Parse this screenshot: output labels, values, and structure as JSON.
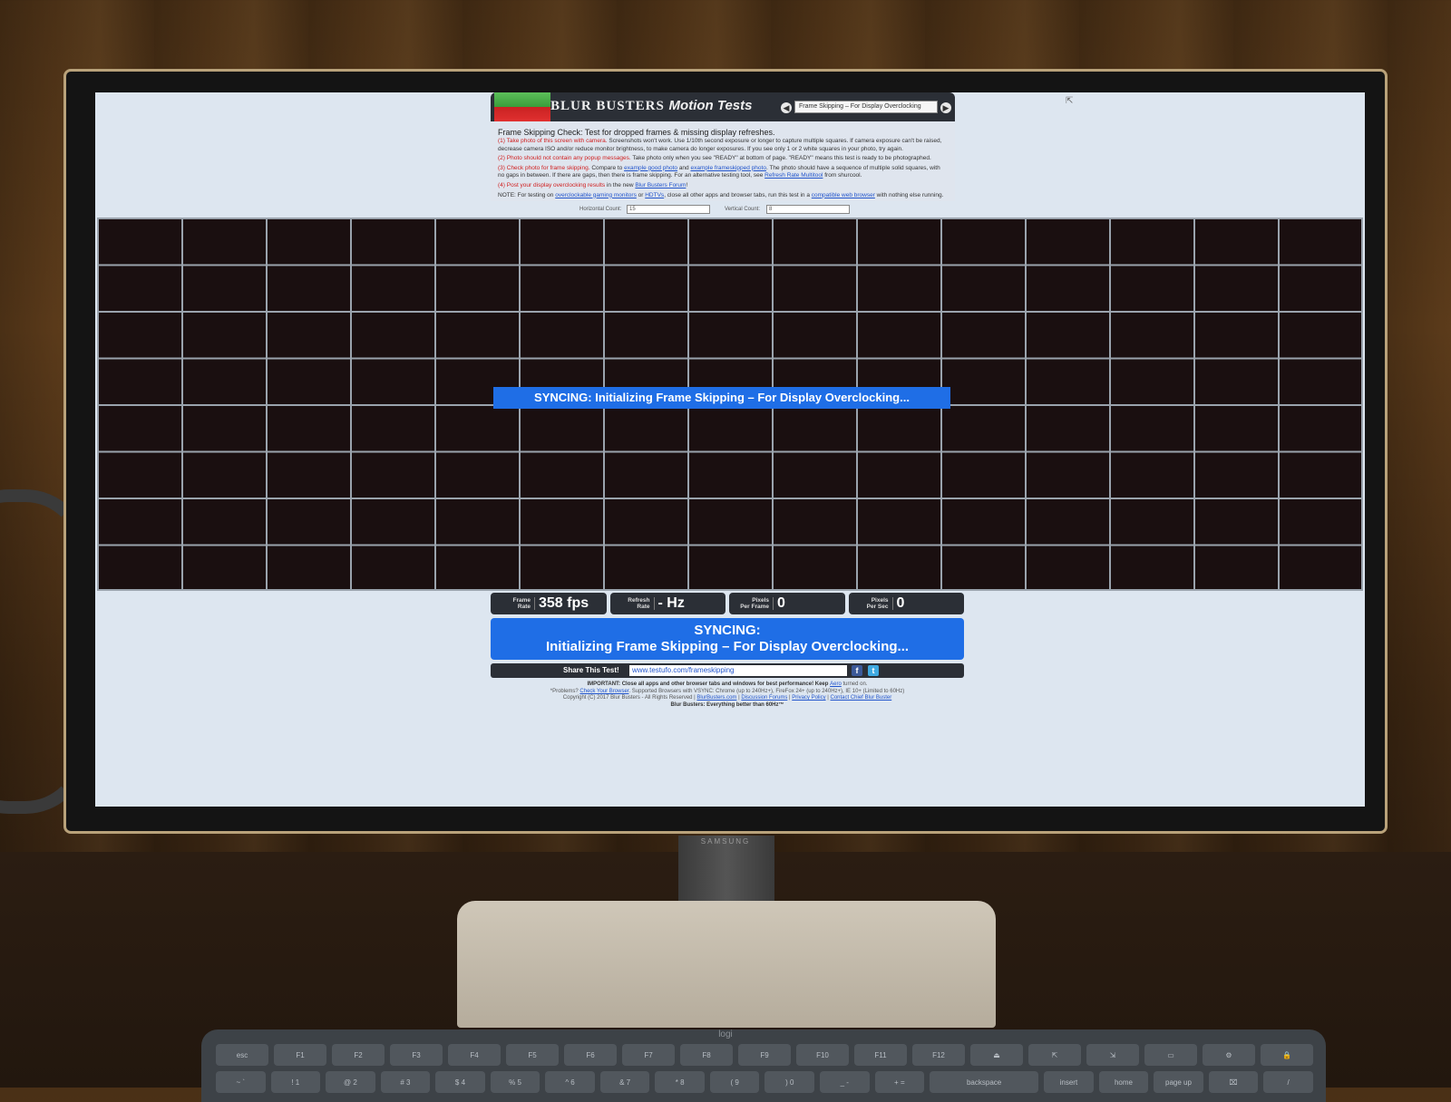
{
  "header": {
    "brand": "BLUR  BUSTERS",
    "brand_suffix": "Motion Tests",
    "test_selector_value": "Frame Skipping – For Display Overclocking"
  },
  "description": {
    "title": "Frame Skipping Check: Test for dropped frames & missing display refreshes.",
    "step1_red": "(1) Take photo of this screen with camera.",
    "step1_text": " Screenshots won't work. Use 1/10th second exposure or longer to capture multiple squares. If camera exposure can't be raised, decrease camera ISO and/or reduce monitor brightness, to make camera do longer exposures. If you see only 1 or 2 white squares in your photo, try again.",
    "step2_red": "(2) Photo should not contain any popup messages.",
    "step2_text": " Take photo only when you see \"READY\" at bottom of page. \"READY\" means this test is ready to be photographed.",
    "step3_red": "(3) Check photo for frame skipping.",
    "step3_text_a": " Compare to ",
    "step3_link_a": "example good photo",
    "step3_text_b": " and ",
    "step3_link_b": "example frameskipped photo",
    "step3_text_c": ". The photo should have a sequence of multiple solid squares, with no gaps in between. If there are gaps, then there is frame skipping. For an alternative testing tool, see ",
    "step3_link_c": "Refresh Rate Multitool",
    "step3_text_d": " from shurcool.",
    "step4_red": "(4) Post your display overclocking results",
    "step4_text": " in the new ",
    "step4_link": "Blur Busters Forum",
    "step4_end": "!",
    "note_a": "NOTE: For testing on ",
    "note_link_a": "overclockable gaming monitors",
    "note_b": " or ",
    "note_link_b": "HDTVs",
    "note_c": ", close all other apps and browser tabs, run this test in a ",
    "note_link_c": "compatible web browser",
    "note_d": " with nothing else running."
  },
  "counts": {
    "horizontal_label": "Horizontal Count:",
    "horizontal_value": "15",
    "vertical_label": "Vertical Count:",
    "vertical_value": "8"
  },
  "overlay": {
    "sync_banner": "SYNCING: Initializing Frame Skipping – For Display Overclocking..."
  },
  "stats": {
    "frame_rate_label_1": "Frame",
    "frame_rate_label_2": "Rate",
    "frame_rate_value": "358 fps",
    "refresh_rate_label_1": "Refresh",
    "refresh_rate_label_2": "Rate",
    "refresh_rate_value": "- Hz",
    "ppf_label_1": "Pixels",
    "ppf_label_2": "Per Frame",
    "ppf_value": "0",
    "pps_label_1": "Pixels",
    "pps_label_2": "Per Sec",
    "pps_value": "0"
  },
  "status": {
    "line1": "SYNCING:",
    "line2": "Initializing Frame Skipping – For Display Overclocking..."
  },
  "share": {
    "label": "Share This Test!",
    "url": "www.testufo.com/frameskipping",
    "facebook_icon": "f",
    "twitter_icon": "t"
  },
  "footer": {
    "important_a": "IMPORTANT: Close all apps and other browser tabs and windows for best performance! Keep ",
    "important_link": "Aero",
    "important_b": " turned on.",
    "problems_a": "*Problems? ",
    "problems_link": "Check Your Browser",
    "problems_b": ". Supported Browsers with VSYNC: Chrome (up to 240Hz+), FireFox 24+ (up to 240Hz+), IE 10+ (Limited to 60Hz)",
    "copyright": "Copyright (C) 2017 Blur Busters - All Rights Reserved | ",
    "link_site": "BlurBusters.com",
    "sep1": " | ",
    "link_forums": "Discussion Forums",
    "sep2": " | ",
    "link_privacy": "Privacy Policy",
    "sep3": " | ",
    "link_contact": "Contact Chief Blur Buster",
    "tagline": "Blur Busters: Everything better than 60Hz™"
  },
  "monitor": {
    "brand": "SAMSUNG"
  },
  "keyboard": {
    "logo": "logi",
    "row1": [
      "esc",
      "F1",
      "F2",
      "F3",
      "F4",
      "F5",
      "F6",
      "F7",
      "F8",
      "F9",
      "F10",
      "F11",
      "F12",
      "⏏",
      "⇱",
      "⇲",
      "▭",
      "⚙",
      "🔒"
    ],
    "row2": [
      "~ `",
      "! 1",
      "@ 2",
      "# 3",
      "$ 4",
      "% 5",
      "^ 6",
      "& 7",
      "* 8",
      "( 9",
      ") 0",
      "_ -",
      "+ =",
      "backspace",
      "insert",
      "home",
      "page up",
      "⌧",
      "/"
    ]
  }
}
